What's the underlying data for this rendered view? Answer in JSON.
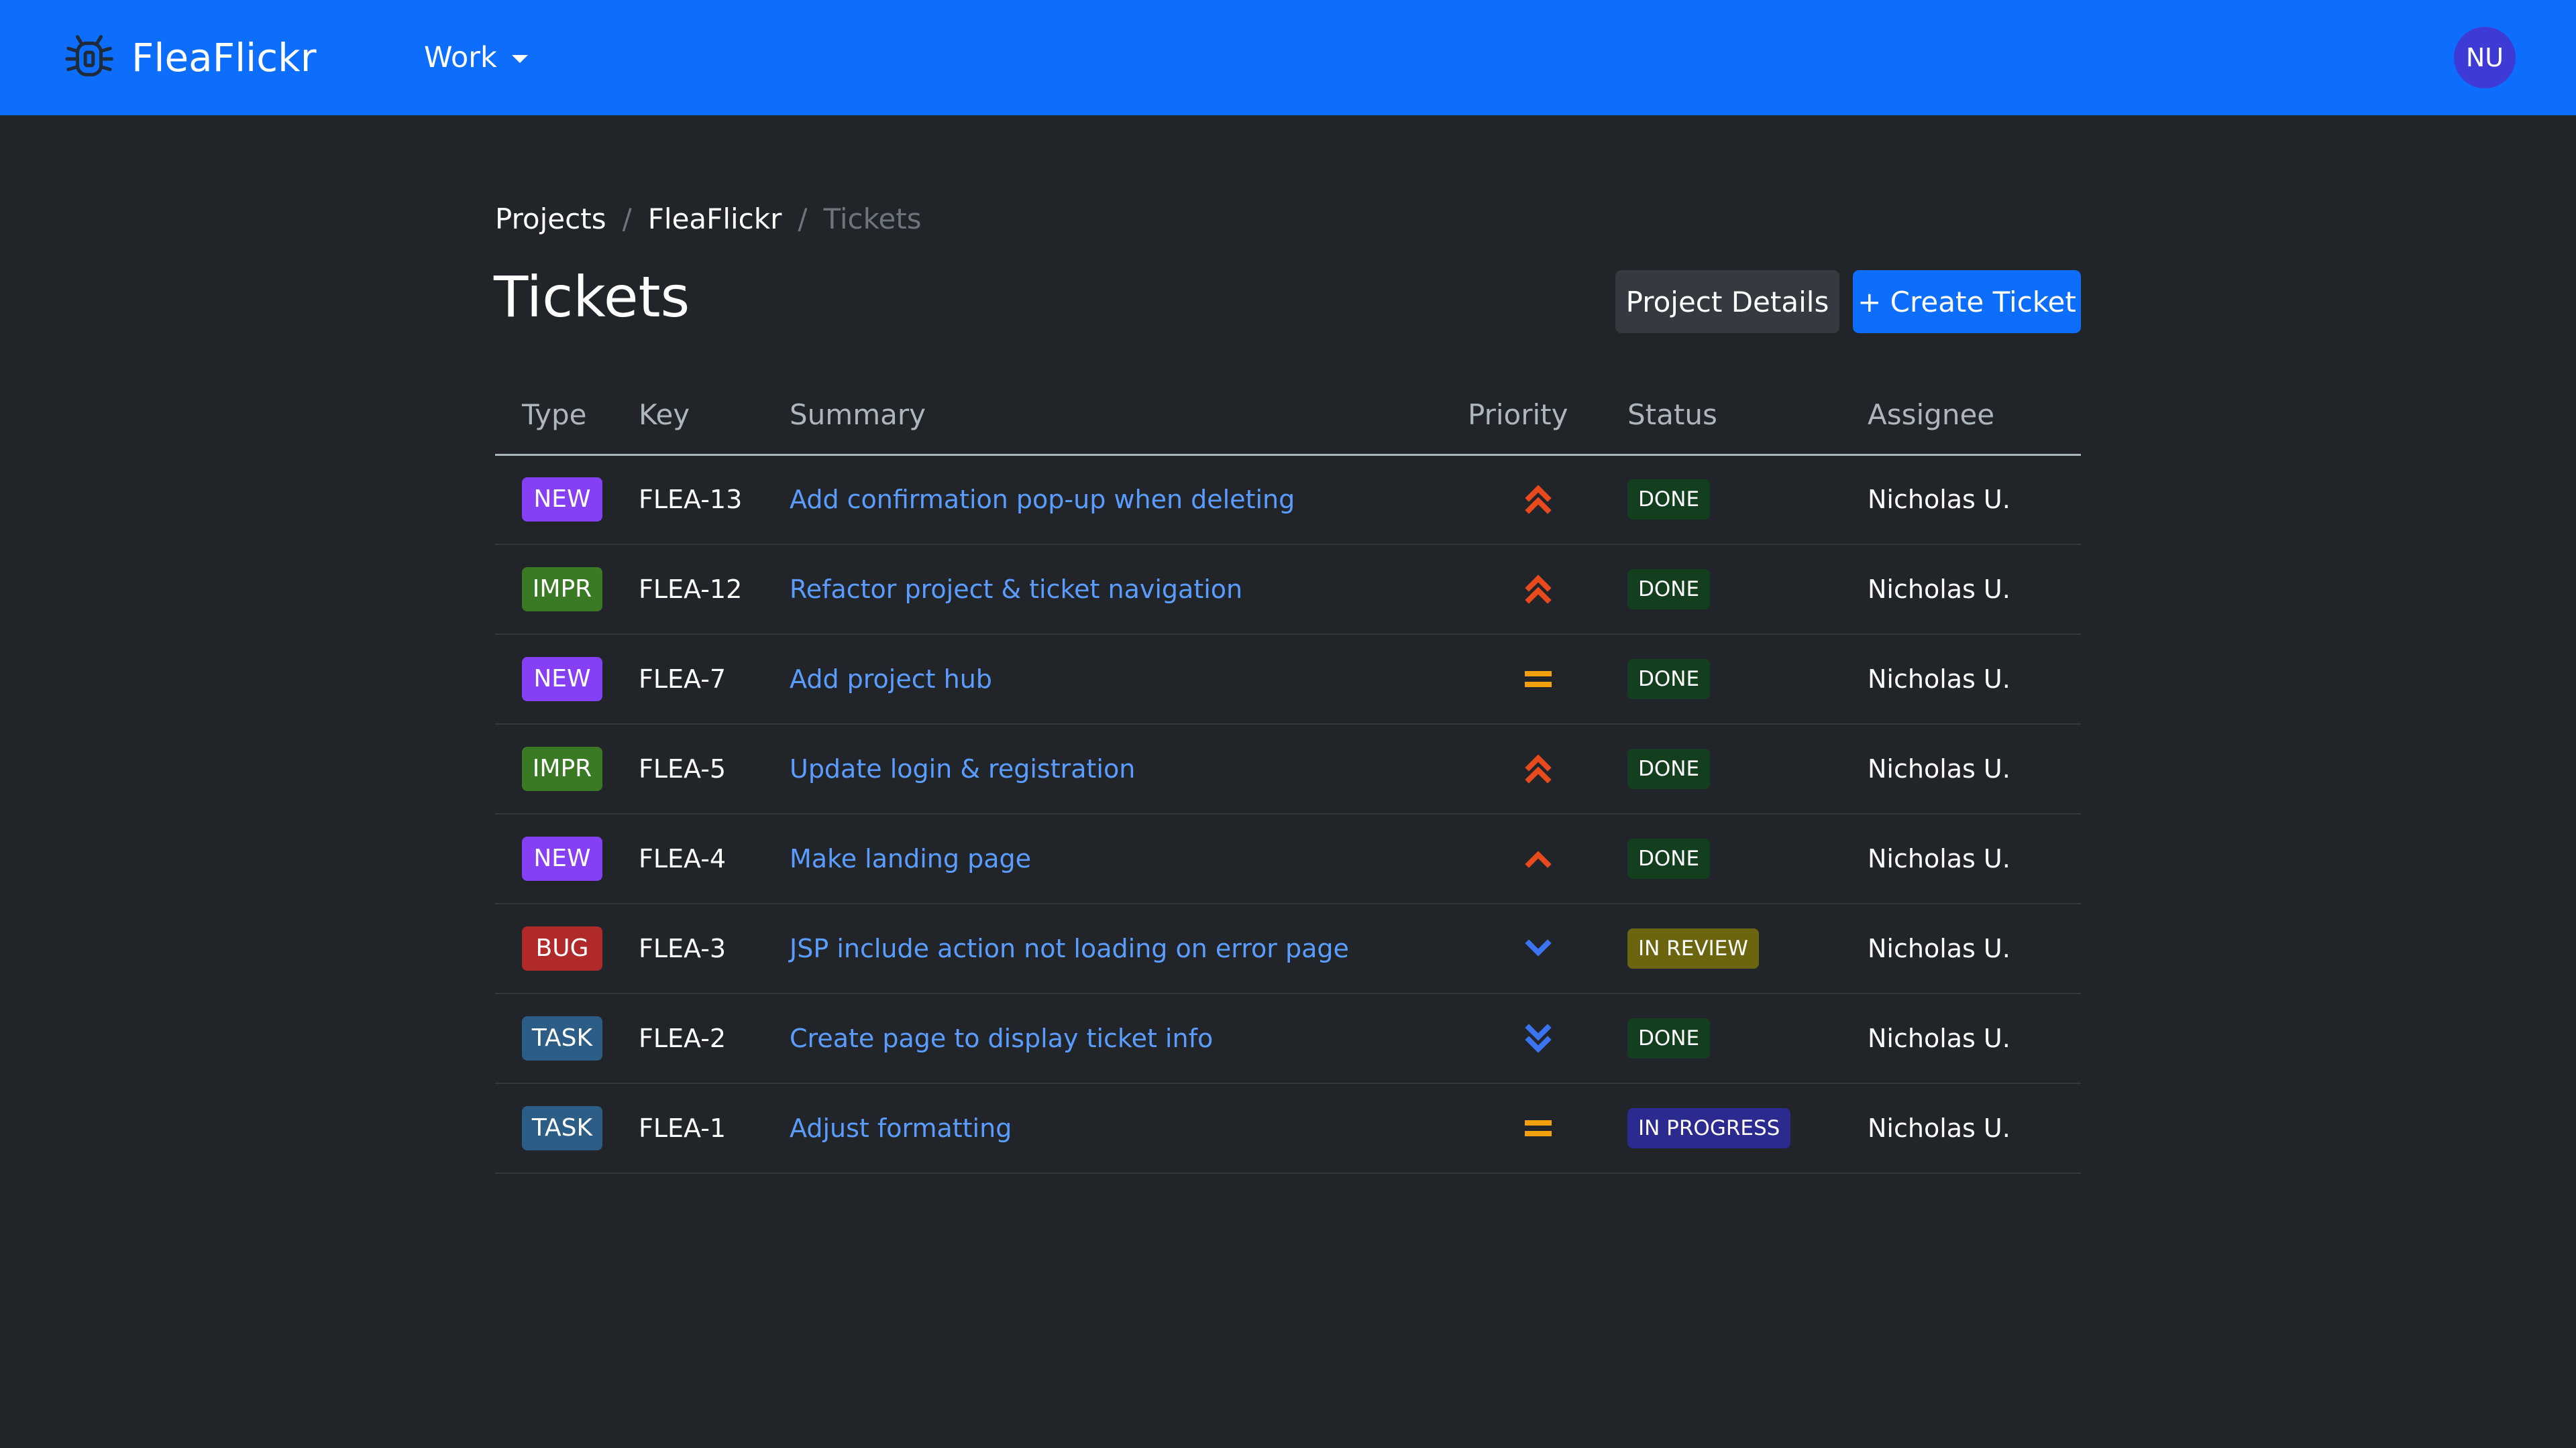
{
  "app": {
    "brand": "FleaFlickr",
    "brand_icon": "bug-icon",
    "nav_work": "Work",
    "avatar_initials": "NU"
  },
  "breadcrumb": {
    "projects": "Projects",
    "project": "FleaFlickr",
    "current": "Tickets",
    "separator": "/"
  },
  "page": {
    "title": "Tickets",
    "project_details_button": "Project Details",
    "create_ticket_button": "+ Create Ticket"
  },
  "table": {
    "columns": [
      "Type",
      "Key",
      "Summary",
      "Priority",
      "Status",
      "Assignee"
    ],
    "rows": [
      {
        "type": "NEW",
        "type_color": "#8540f5",
        "key": "FLEA-13",
        "summary": "Add confirmation pop-up when deleting",
        "priority": "highest",
        "priority_icon": "double-chevron-up-icon",
        "status": "DONE",
        "status_color": "#133f1f",
        "assignee": "Nicholas U."
      },
      {
        "type": "IMPR",
        "type_color": "#3b7a25",
        "key": "FLEA-12",
        "summary": "Refactor project & ticket navigation",
        "priority": "highest",
        "priority_icon": "double-chevron-up-icon",
        "status": "DONE",
        "status_color": "#133f1f",
        "assignee": "Nicholas U."
      },
      {
        "type": "NEW",
        "type_color": "#8540f5",
        "key": "FLEA-7",
        "summary": "Add project hub",
        "priority": "medium",
        "priority_icon": "equals-icon",
        "status": "DONE",
        "status_color": "#133f1f",
        "assignee": "Nicholas U."
      },
      {
        "type": "IMPR",
        "type_color": "#3b7a25",
        "key": "FLEA-5",
        "summary": "Update login & registration",
        "priority": "highest",
        "priority_icon": "double-chevron-up-icon",
        "status": "DONE",
        "status_color": "#133f1f",
        "assignee": "Nicholas U."
      },
      {
        "type": "NEW",
        "type_color": "#8540f5",
        "key": "FLEA-4",
        "summary": "Make landing page",
        "priority": "high",
        "priority_icon": "chevron-up-icon",
        "status": "DONE",
        "status_color": "#133f1f",
        "assignee": "Nicholas U."
      },
      {
        "type": "BUG",
        "type_color": "#b02a2a",
        "key": "FLEA-3",
        "summary": "JSP include action not loading on error page",
        "priority": "low",
        "priority_icon": "chevron-down-icon",
        "status": "IN REVIEW",
        "status_color": "#6b6510",
        "assignee": "Nicholas U."
      },
      {
        "type": "TASK",
        "type_color": "#2b5d86",
        "key": "FLEA-2",
        "summary": "Create page to display ticket info",
        "priority": "lowest",
        "priority_icon": "double-chevron-down-icon",
        "status": "DONE",
        "status_color": "#133f1f",
        "assignee": "Nicholas U."
      },
      {
        "type": "TASK",
        "type_color": "#2b5d86",
        "key": "FLEA-1",
        "summary": "Adjust formatting",
        "priority": "medium",
        "priority_icon": "equals-icon",
        "status": "IN PROGRESS",
        "status_color": "#2a2a8f",
        "assignee": "Nicholas U."
      }
    ]
  },
  "colors": {
    "navbar": "#0d6efd",
    "background": "#212529",
    "link": "#5b9dff",
    "priority_high": "#e8491d",
    "priority_medium": "#f4a10b",
    "priority_low": "#3b73f0"
  }
}
